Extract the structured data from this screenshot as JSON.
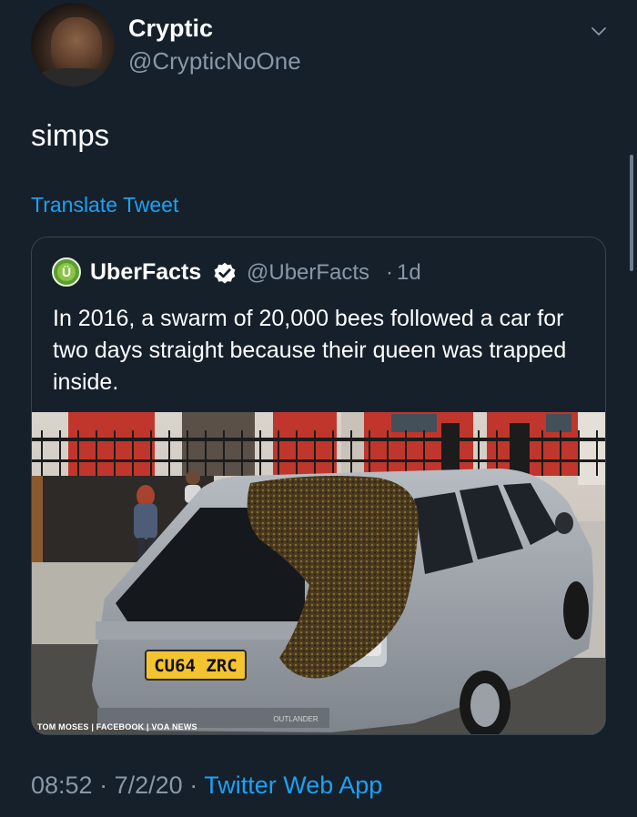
{
  "author": {
    "name": "Cryptic",
    "handle": "@CrypticNoOne",
    "avatar_icon": "profile-photo"
  },
  "tweet": {
    "text": "simps",
    "translate_label": "Translate Tweet",
    "time": "08:52",
    "separator": "·",
    "date": "7/2/20",
    "source": "Twitter Web App"
  },
  "quoted": {
    "name": "UberFacts",
    "verified_icon": "verified-badge-icon",
    "handle": "@UberFacts",
    "separator": "·",
    "age": "1d",
    "avatar_letter": "Ü",
    "text": "In 2016, a swarm of 20,000 bees followed a car for two days straight because their queen was trapped inside.",
    "photo": {
      "plate": "CU64 ZRC",
      "credit": "TOM MOSES | FACEBOOK | VOA NEWS",
      "model_badge": "OUTLANDER"
    }
  },
  "colors": {
    "background": "#15202b",
    "accent": "#1da1f2",
    "secondary_text": "#8899a6",
    "border": "#38444d"
  }
}
